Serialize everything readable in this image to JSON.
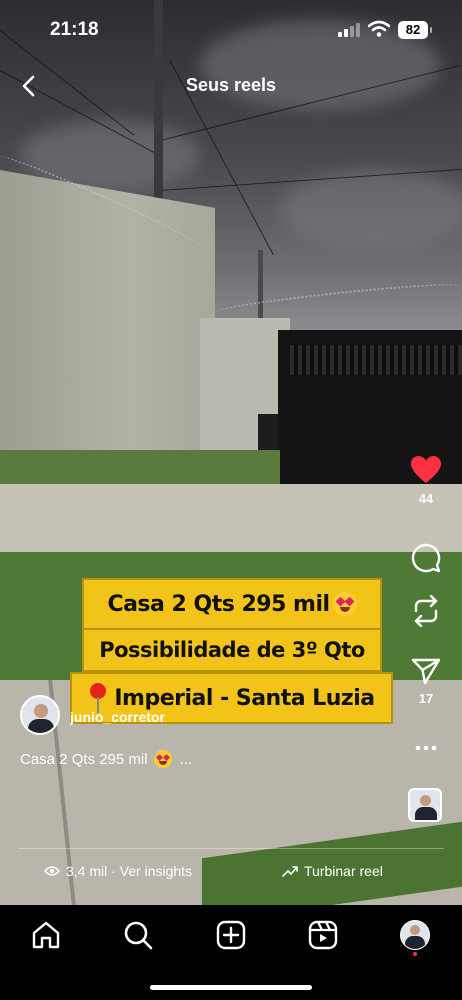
{
  "status_bar": {
    "time": "21:18",
    "battery": "82"
  },
  "header": {
    "title": "Seus reels"
  },
  "overlay_captions": {
    "line1": "Casa 2 Qts 295 mil",
    "line2": "Possibilidade de 3º Qto",
    "line3": "Imperial - Santa Luzia"
  },
  "actions": {
    "likes": "44",
    "shares": "17"
  },
  "author": {
    "username": "junio_corretor"
  },
  "description": {
    "text": "Casa 2 Qts 295 mil",
    "more": "..."
  },
  "insights": {
    "views": "3,4 mil · Ver insights",
    "boost": "Turbinar reel"
  },
  "icons": {
    "back": "chevron-left-icon",
    "like": "heart-icon",
    "comment": "comment-icon",
    "repost": "repost-icon",
    "share": "send-icon",
    "more": "more-icon",
    "views": "eye-icon",
    "boost": "trend-icon",
    "nav": [
      "home-icon",
      "search-icon",
      "add-icon",
      "reels-icon",
      "profile-avatar"
    ]
  },
  "colors": {
    "like": "#ff3040",
    "caption_bg": "#f2c318",
    "nav_bg": "#000000"
  }
}
